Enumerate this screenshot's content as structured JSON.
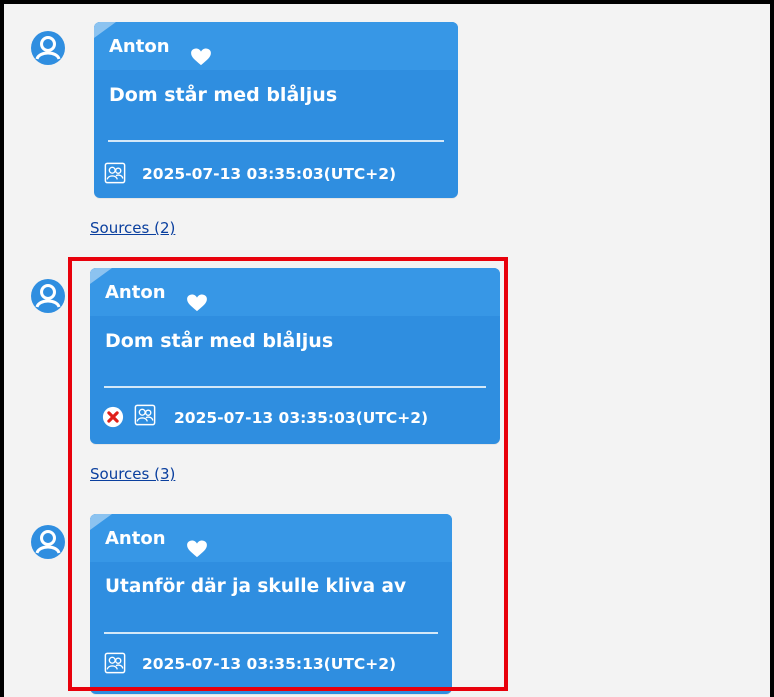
{
  "messages": [
    {
      "sender": "Anton",
      "text": "Dom står med blåljus",
      "timestamp": "2025-07-13 03:35:03(UTC+2)",
      "sources_label": "Sources (2)",
      "failed": false
    },
    {
      "sender": "Anton",
      "text": "Dom står med blåljus",
      "timestamp": "2025-07-13 03:35:03(UTC+2)",
      "sources_label": "Sources (3)",
      "failed": true
    },
    {
      "sender": "Anton",
      "text": "Utanför där ja skulle kliva av",
      "timestamp": "2025-07-13 03:35:13(UTC+2)",
      "failed": false
    }
  ],
  "colors": {
    "bubble": "#2f8ee0",
    "avatar": "#2f8ee0",
    "highlight_border": "#e8000b",
    "error_icon": "#e0201a",
    "link": "#0a3f9e"
  },
  "icons": {
    "avatar": "user-avatar-icon",
    "favorite": "heart-icon",
    "participants": "group-icon",
    "error": "error-x-icon"
  }
}
